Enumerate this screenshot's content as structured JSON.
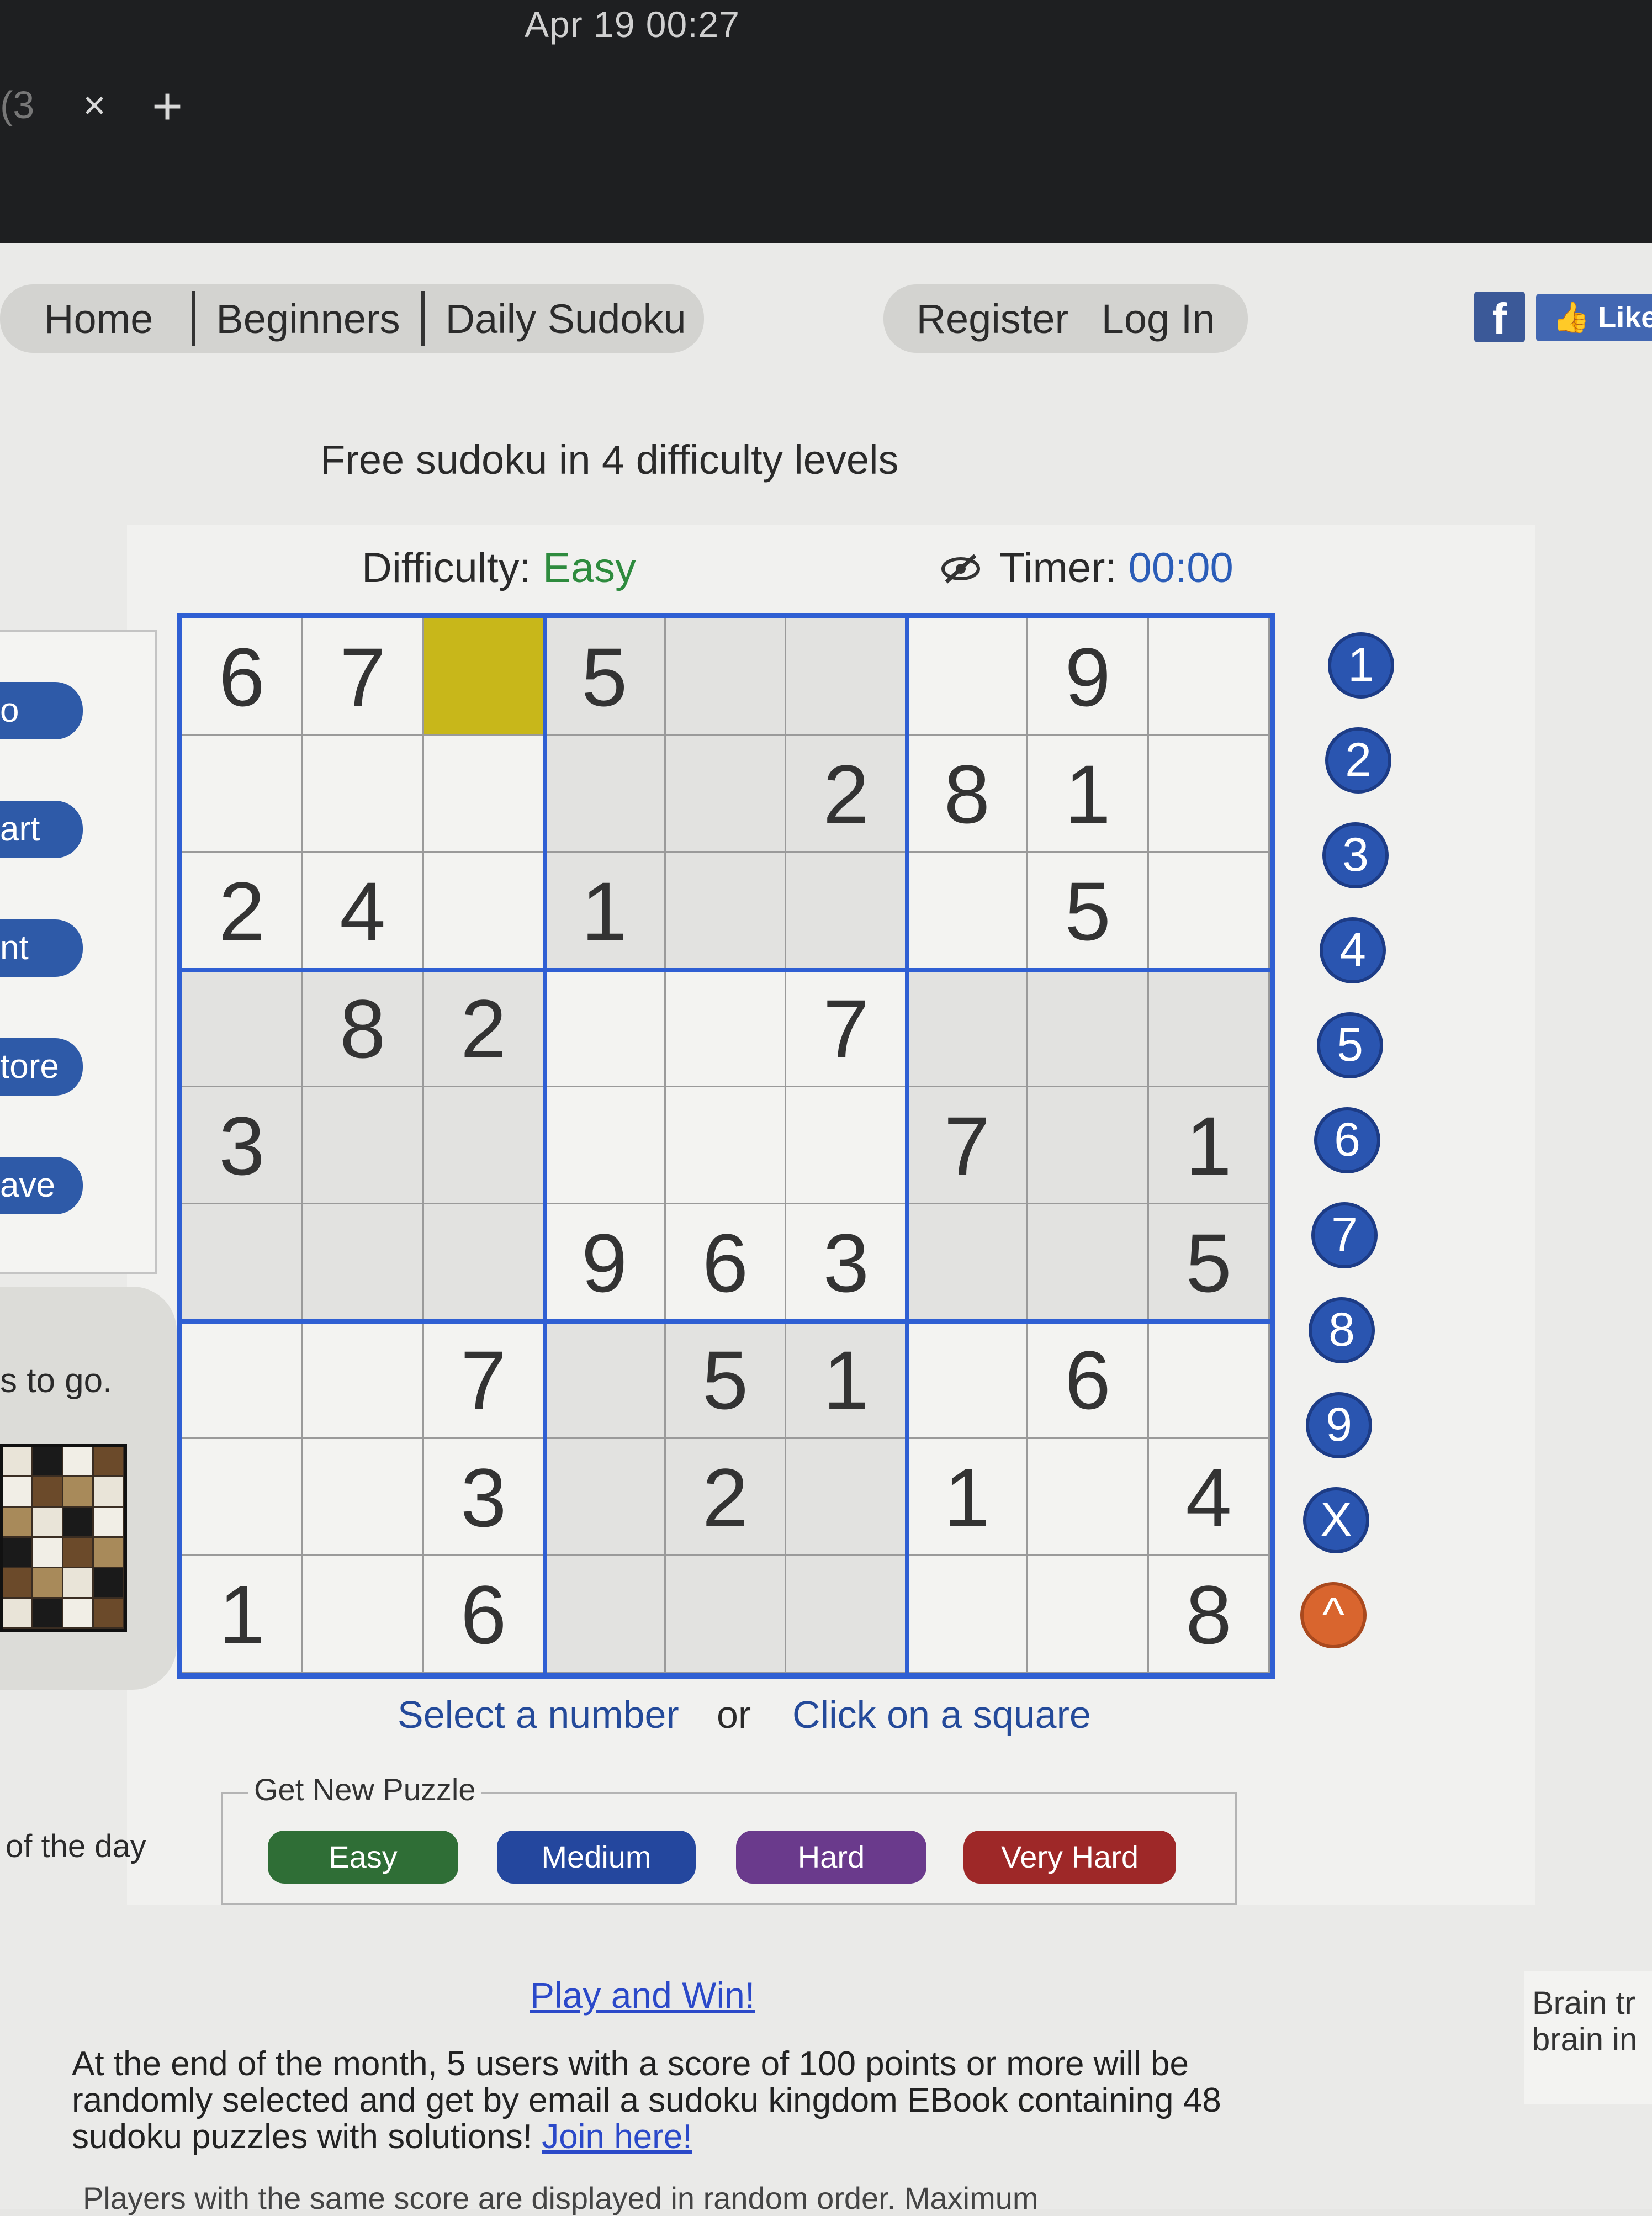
{
  "os": {
    "clock": "Apr 19  00:27",
    "tab_fragment": "(3",
    "tab_close": "×",
    "tab_new": "+"
  },
  "nav": {
    "home": "Home",
    "beginners": "Beginners",
    "daily": "Daily Sudoku",
    "register": "Register",
    "login": "Log In",
    "facebook": "f",
    "like": "Like"
  },
  "headline": "Free sudoku in 4 difficulty levels",
  "status": {
    "difficulty_label": "Difficulty: ",
    "difficulty_value": "Easy",
    "timer_label": "Timer: ",
    "timer_value": "00:00"
  },
  "sidebar": {
    "buttons": [
      "o",
      "art",
      "nt",
      "tore",
      "ave"
    ],
    "togo": "s to go.",
    "ofday": "of the day"
  },
  "board": {
    "selected": [
      0,
      2
    ],
    "rows": [
      [
        "6",
        "7",
        "",
        "5",
        "",
        "",
        "",
        "9",
        ""
      ],
      [
        "",
        "",
        "",
        "",
        "",
        "2",
        "8",
        "1",
        ""
      ],
      [
        "2",
        "4",
        "",
        "1",
        "",
        "",
        "",
        "5",
        ""
      ],
      [
        "",
        "8",
        "2",
        "",
        "",
        "7",
        "",
        "",
        ""
      ],
      [
        "3",
        "",
        "",
        "",
        "",
        "",
        "7",
        "",
        "1"
      ],
      [
        "",
        "",
        "",
        "9",
        "6",
        "3",
        "",
        "",
        "5"
      ],
      [
        "",
        "",
        "7",
        "",
        "5",
        "1",
        "",
        "6",
        ""
      ],
      [
        "",
        "",
        "3",
        "",
        "2",
        "",
        "1",
        "",
        "4"
      ],
      [
        "1",
        "",
        "6",
        "",
        "",
        "",
        "",
        "",
        "8"
      ]
    ]
  },
  "numpad": {
    "numbers": [
      "1",
      "2",
      "3",
      "4",
      "5",
      "6",
      "7",
      "8",
      "9"
    ],
    "clear": "X",
    "undo": "^"
  },
  "help": {
    "select": "Select a number",
    "or": "or",
    "click": "Click on a square"
  },
  "new_puzzle": {
    "legend": "Get New Puzzle",
    "buttons": [
      {
        "label": "Easy",
        "color": "#2f6e36"
      },
      {
        "label": "Medium",
        "color": "#24479e"
      },
      {
        "label": "Hard",
        "color": "#6a3a8c"
      },
      {
        "label": "Very Hard",
        "color": "#9e2828"
      }
    ]
  },
  "promo": {
    "link": "Play and Win!",
    "text": "At the end of the month, 5 users with a score of 100 points or more will be randomly selected and get by email a sudoku kingdom EBook containing 48 sudoku puzzles with solutions! ",
    "join": "Join here!",
    "players": "Players with the same score are displayed in random order. Maximum"
  },
  "brain": {
    "line1": "Brain tr",
    "line2": "brain in"
  },
  "colors": {
    "grid_border": "#2f5fd3",
    "selected_cell": "#c8b71a",
    "difficulty_green": "#2e8b3e",
    "timer_blue": "#2b5db8"
  }
}
